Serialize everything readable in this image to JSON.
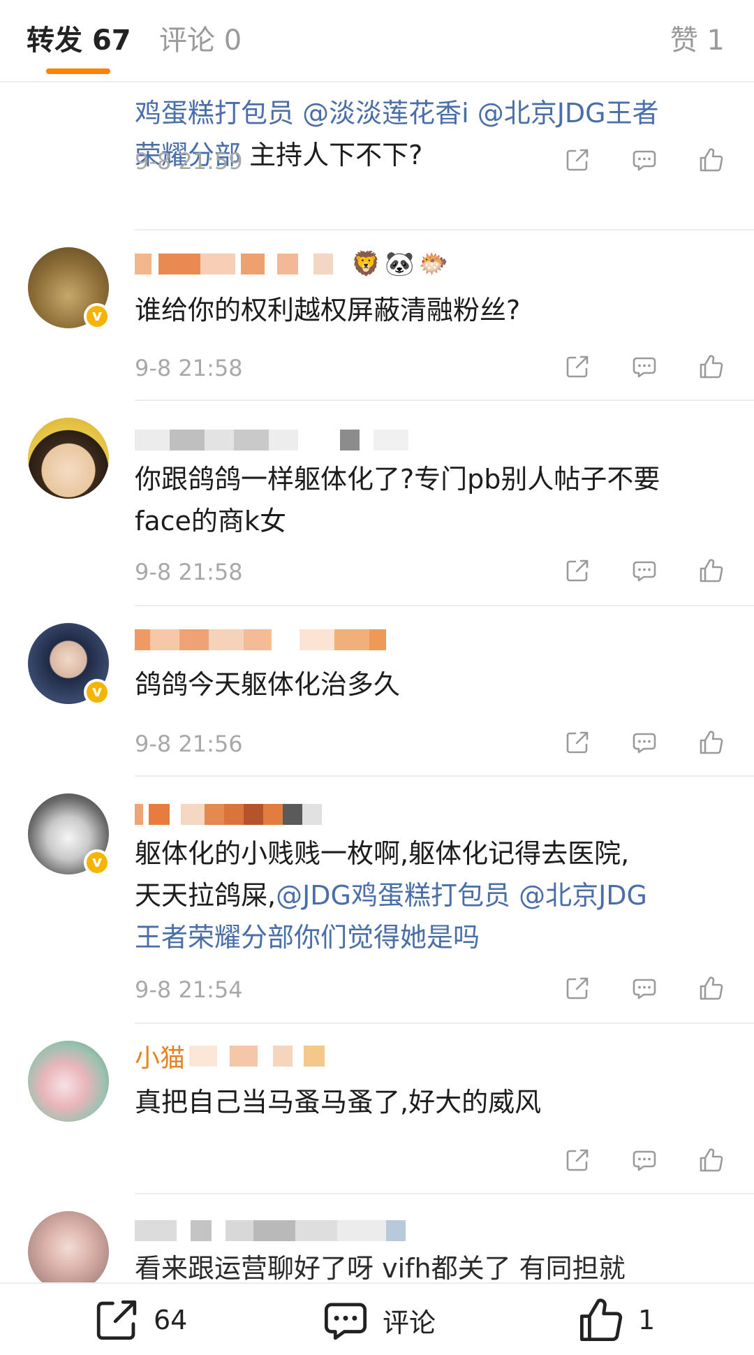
{
  "tabs": {
    "repost_label": "转发",
    "repost_count": "67",
    "comment_label": "评论",
    "comment_count": "0",
    "like_label": "赞",
    "like_count": "1"
  },
  "items": [
    {
      "segments": [
        {
          "text": "鸡蛋糕打包员 @淡淡莲花香i @北京JDG王者",
          "link": true
        },
        {
          "text": "荣耀分部",
          "link": true
        },
        {
          "text": " 主持人下不下?",
          "link": false
        }
      ],
      "time": "9-8 21:59"
    },
    {
      "name_visible": "",
      "verified": true,
      "text": "谁给你的权利越权屏蔽清融粉丝?",
      "time": "9-8 21:58"
    },
    {
      "name_visible": "",
      "verified": false,
      "text_line1": "你跟鸽鸽一样躯体化了?专门pb别人帖子不要",
      "text_line2": "face的商k女",
      "time": "9-8 21:58"
    },
    {
      "name_visible": "",
      "verified": true,
      "text": "鸽鸽今天躯体化治多久",
      "time": "9-8 21:56"
    },
    {
      "name_visible": "",
      "verified": true,
      "text_line1": "躯体化的小贱贱一枚啊,躯体化记得去医院,",
      "text_line2_plain": "天天拉鸽屎,",
      "text_line2_link": "@JDG鸡蛋糕打包员 @北京JDG",
      "text_line3_link": "王者荣耀分部你们觉得她是吗",
      "time": "9-8 21:54"
    },
    {
      "name_visible": "小猫",
      "verified": false,
      "text": "真把自己当马蚤马蚤了,好大的威风",
      "time": ""
    },
    {
      "name_visible": "",
      "verified": false,
      "text": "看来跟运营聊好了呀 vifh都关了 有同担就",
      "time": ""
    }
  ],
  "bottombar": {
    "repost_count": "64",
    "comment_label": "评论",
    "like_count": "1"
  },
  "colors": {
    "accent": "#ff8200",
    "link": "#4a6ea8",
    "muted": "#a8a8a8",
    "verified": "#f5b400"
  },
  "icons": {
    "action_share": "share-icon",
    "action_comment": "comment-icon",
    "action_like": "thumbs-up-icon"
  }
}
